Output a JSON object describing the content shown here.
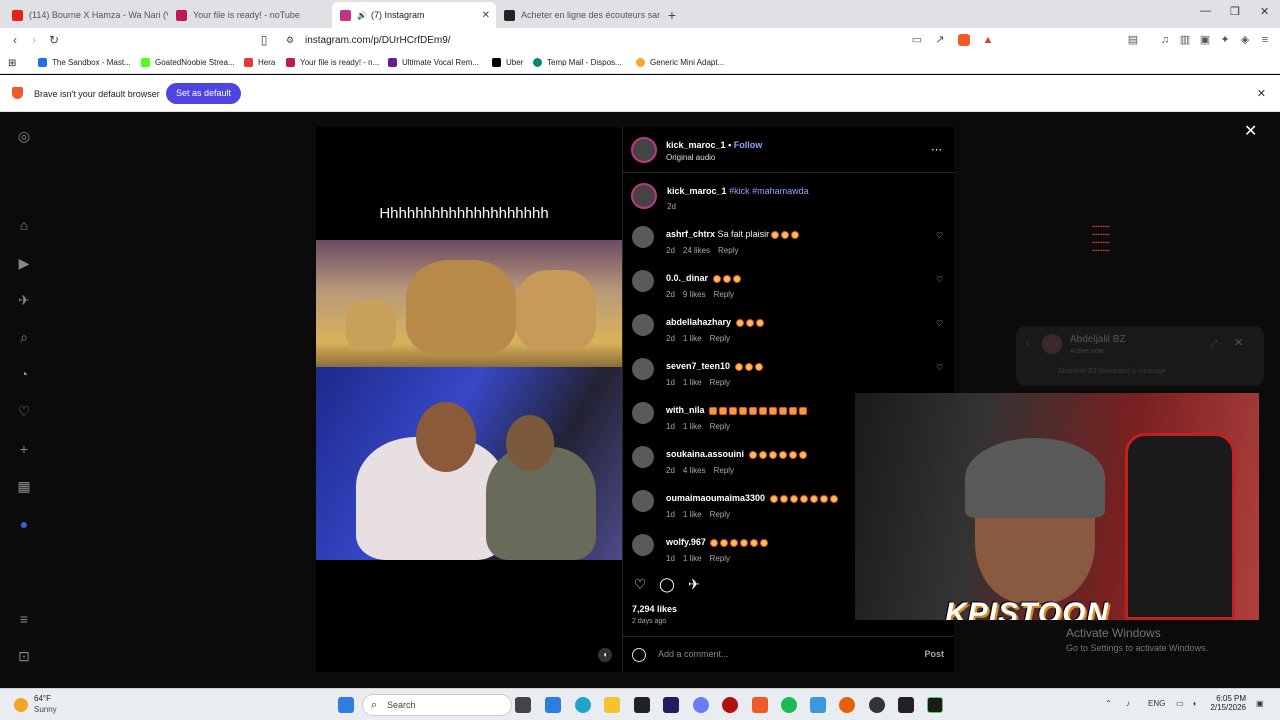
{
  "tabs": [
    {
      "title": "(114) Bourne X Hamza - Wa Nari (Vid",
      "color": "#e62117"
    },
    {
      "title": "Your file is ready! - noTube",
      "color": "#c2185b"
    },
    {
      "title": "(7) Instagram",
      "color": "#c13584",
      "active": true
    },
    {
      "title": "Acheter en ligne des écouteurs sans fi",
      "color": "#222222"
    }
  ],
  "url": "instagram.com/p/DUrHCrfDEm9/",
  "bookmarks": [
    {
      "label": "The Sandbox - Mast...",
      "color": "#1a73e8"
    },
    {
      "label": "GoatedNoobie Strea...",
      "color": "#53fc18"
    },
    {
      "label": "Hera",
      "color": "#e53935"
    },
    {
      "label": "Your file is ready! - n...",
      "color": "#c2185b"
    },
    {
      "label": "Ultimate Vocal Rem...",
      "color": "#6a1b9a"
    },
    {
      "label": "Uber",
      "color": "#000000"
    },
    {
      "label": "Temp Mail - Dispos...",
      "color": "#00897b"
    },
    {
      "label": "Generic Mini Adapt...",
      "color": "#f9a825"
    }
  ],
  "banner": {
    "text": "Brave isn't your default browser",
    "button": "Set as default"
  },
  "post": {
    "caption_overlay": "Hhhhhhhhhhhhhhhhhhhh",
    "author": "kick_maroc_1",
    "follow": "Follow",
    "audio": "Original audio",
    "caption_user": "kick_maroc_1",
    "caption_tags": "#kick #mahamawda",
    "caption_time": "2d",
    "likes": "7,294 likes",
    "ago": "2 days ago",
    "add_comment": "Add a comment...",
    "post_btn": "Post"
  },
  "comments": [
    {
      "user": "ashrf_chtrx",
      "text": "Sa fait plaisir",
      "emojis": 3,
      "time": "2d",
      "likes": "24 likes",
      "reply": "Reply",
      "cat": false
    },
    {
      "user": "0.0._dinar",
      "text": "",
      "emojis": 3,
      "time": "2d",
      "likes": "9 likes",
      "reply": "Reply",
      "cat": false
    },
    {
      "user": "abdellahazhary",
      "text": "",
      "emojis": 3,
      "time": "2d",
      "likes": "1 like",
      "reply": "Reply",
      "cat": false
    },
    {
      "user": "seven7_teen10",
      "text": "",
      "emojis": 3,
      "time": "1d",
      "likes": "1 like",
      "reply": "Reply",
      "cat": false
    },
    {
      "user": "with_nila",
      "text": "",
      "emojis": 10,
      "time": "1d",
      "likes": "1 like",
      "reply": "Reply",
      "cat": true
    },
    {
      "user": "soukaina.assouini",
      "text": "",
      "emojis": 6,
      "time": "2d",
      "likes": "4 likes",
      "reply": "Reply",
      "cat": false
    },
    {
      "user": "oumaimaoumaima3300",
      "text": "",
      "emojis": 7,
      "time": "1d",
      "likes": "1 like",
      "reply": "Reply",
      "cat": false
    },
    {
      "user": "wolfy.967",
      "text": "",
      "emojis": 6,
      "time": "1d",
      "likes": "1 like",
      "reply": "Reply",
      "cat": false
    }
  ],
  "dm": {
    "name": "Abdeljalil BZ",
    "status": "Active now",
    "forwarded": "Abdeljalil BZ forwarded a message"
  },
  "overlay_brand": "KPISTOON",
  "activate": {
    "title": "Activate Windows",
    "sub": "Go to Settings to activate Windows."
  },
  "taskbar": {
    "temp": "64°F",
    "weather": "Sunny",
    "search": "Search",
    "lang": "ENG",
    "time": "6:05 PM",
    "date": "2/15/2026"
  }
}
